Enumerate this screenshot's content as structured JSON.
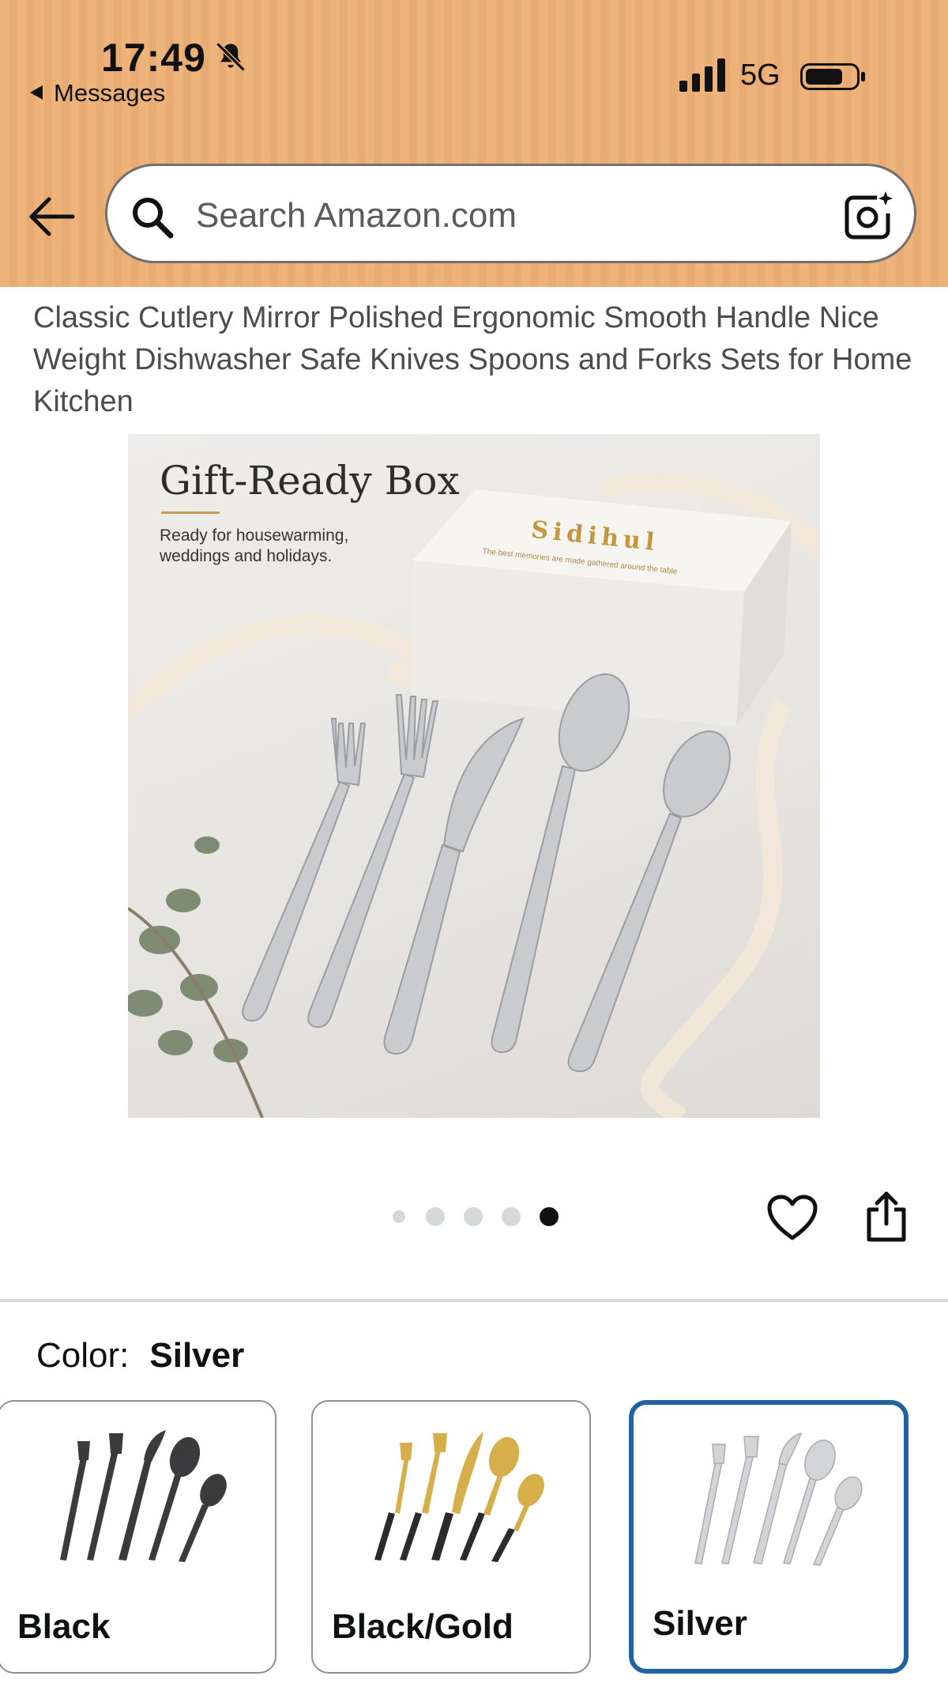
{
  "status_bar": {
    "time": "17:49",
    "back_label": "Messages",
    "network": "5G"
  },
  "search": {
    "placeholder": "Search Amazon.com"
  },
  "product": {
    "title": "Classic Cutlery Mirror Polished Ergonomic Smooth Handle Nice Weight Dishwasher Safe Knives Spoons and Forks Sets for Home Kitchen"
  },
  "image": {
    "heading": "Gift-Ready Box",
    "subtext": "Ready for housewarming, weddings and holidays.",
    "brand": "Sidihul",
    "tagline": "The best memories are made gathered around the table",
    "carousel": {
      "count": 5,
      "active": 5
    }
  },
  "color": {
    "label": "Color:",
    "selected": "Silver",
    "options": [
      {
        "name": "Black"
      },
      {
        "name": "Black/Gold"
      },
      {
        "name": "Silver"
      }
    ]
  },
  "colors": {
    "header_bg": "#eeb37b",
    "selected_border": "#2162a1",
    "divider": "#d5dbdb"
  }
}
